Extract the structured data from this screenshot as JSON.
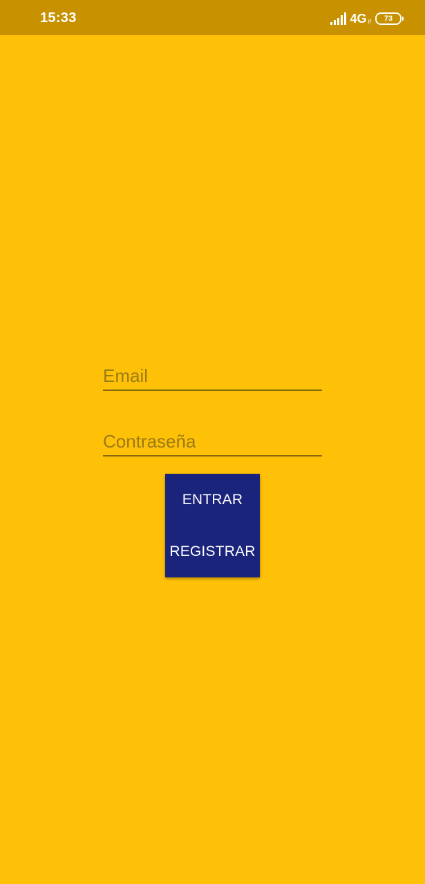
{
  "status_bar": {
    "time": "15:33",
    "network": "4G",
    "network_sub": "if",
    "battery_level": "73",
    "icons": [
      "signal-icon",
      "battery-icon"
    ]
  },
  "form": {
    "email_placeholder": "Email",
    "password_placeholder": "Contraseña",
    "enter_label": "ENTRAR",
    "register_label": "REGISTRAR"
  },
  "colors": {
    "background": "#FFC107",
    "status_bar": "#C79100",
    "button": "#1B247C",
    "button_text": "#FFFFFF",
    "placeholder": "#9C7A16",
    "underline": "#8A6A10"
  }
}
